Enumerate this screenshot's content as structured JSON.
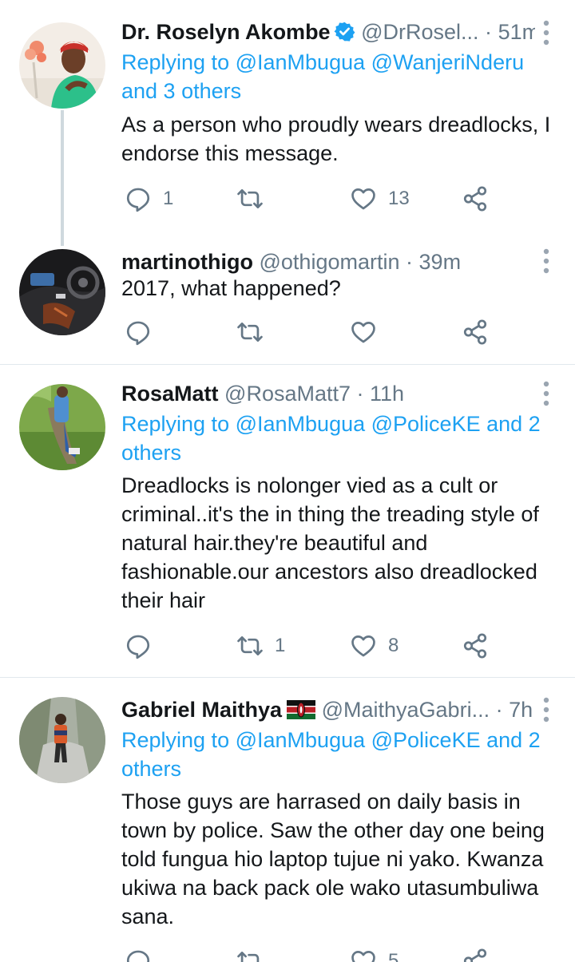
{
  "tweets": [
    {
      "name": "Dr. Roselyn Akombe",
      "verified": true,
      "handle": "@DrRosel...",
      "dot": "·",
      "time": "51m",
      "replying_prefix": "Replying to",
      "replying_targets": "@IanMbugua @WanjeriNderu",
      "replying_more": "and 3 others",
      "text": "As a person who proudly wears dreadlocks, I endorse this message.",
      "replies": "1",
      "retweets": "",
      "likes": "13"
    },
    {
      "name": "martinothigo",
      "handle": "@othigomartin",
      "dot": "·",
      "time": "39m",
      "text": "2017, what happened?",
      "replies": "",
      "retweets": "",
      "likes": ""
    },
    {
      "name": "RosaMatt",
      "handle": "@RosaMatt7",
      "dot": "·",
      "time": "11h",
      "replying_prefix": "Replying to",
      "replying_targets": "@IanMbugua @PoliceKE and 2 others",
      "text": "Dreadlocks is nolonger vied as a cult or criminal..it's the in thing the treading style of natural hair.they're beautiful and fashionable.our ancestors also dreadlocked their hair",
      "replies": "",
      "retweets": "1",
      "likes": "8"
    },
    {
      "name": "Gabriel Maithya",
      "flag": "kenya-flag",
      "handle": "@MaithyaGabri...",
      "dot": "·",
      "time": "7h",
      "replying_prefix": "Replying to",
      "replying_targets": "@IanMbugua @PoliceKE and 2 others",
      "text": "Those guys are harrased on daily basis in town by police. Saw the other day one being told fungua hio laptop tujue ni yako. Kwanza ukiwa na back pack ole wako utasumbuliwa sana.",
      "replies": "",
      "retweets": "",
      "likes": "5"
    }
  ],
  "colors": {
    "link": "#1da1f2",
    "secondary": "#657786",
    "divider": "#e1e8ed",
    "thread_line": "#cfd9de"
  },
  "icons": [
    "reply-icon",
    "retweet-icon",
    "like-icon",
    "share-icon",
    "more-icon",
    "verified-icon"
  ]
}
